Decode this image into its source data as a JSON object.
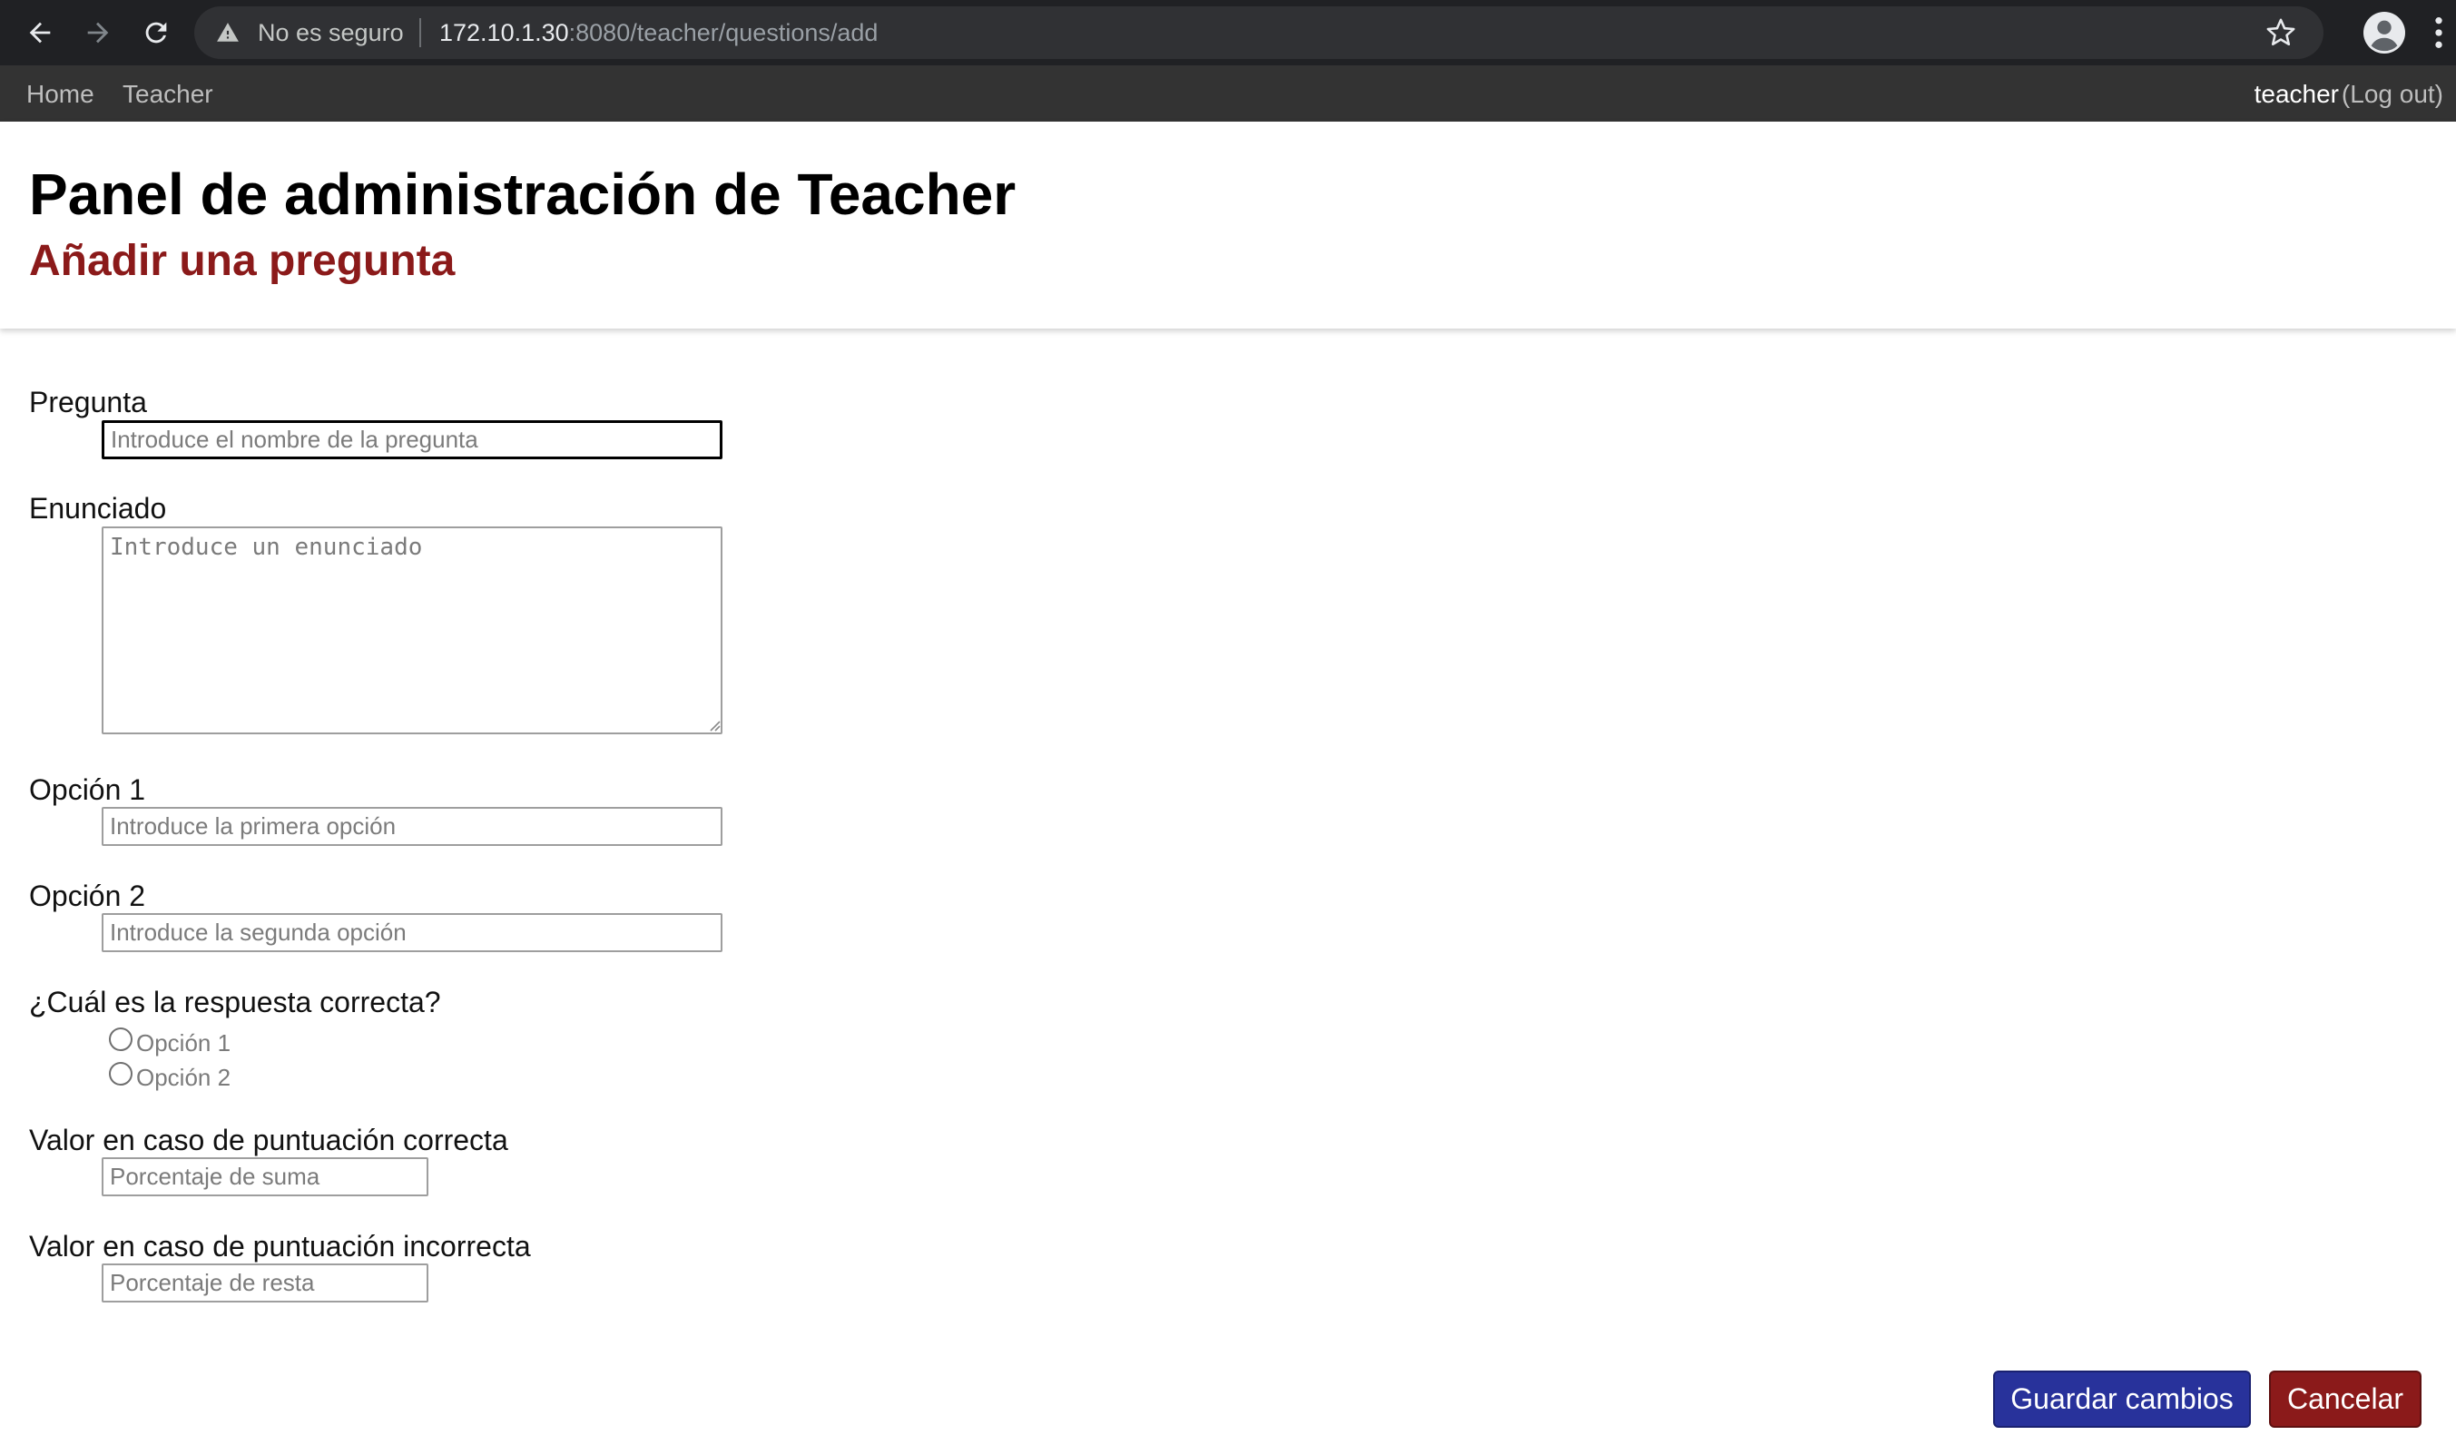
{
  "browser": {
    "security_text": "No es seguro",
    "url_host": "172.10.1.30",
    "url_rest": ":8080/teacher/questions/add",
    "icons": [
      "back-icon",
      "forward-icon",
      "reload-icon",
      "warning-icon",
      "bookmark-star-icon",
      "profile-icon",
      "kebab-menu-icon"
    ]
  },
  "navbar": {
    "home": "Home",
    "teacher": "Teacher",
    "user": "teacher",
    "logout_open": "(",
    "logout": "Log out",
    "logout_close": ")"
  },
  "header": {
    "title": "Panel de administración de Teacher",
    "subtitle": "Añadir una pregunta",
    "subtitle_color": "#8b1a1a"
  },
  "form": {
    "question": {
      "label": "Pregunta",
      "placeholder": "Introduce el nombre de la pregunta",
      "value": ""
    },
    "statement": {
      "label": "Enunciado",
      "placeholder": "Introduce un enunciado",
      "value": ""
    },
    "option1": {
      "label": "Opción 1",
      "placeholder": "Introduce la primera opción",
      "value": ""
    },
    "option2": {
      "label": "Opción 2",
      "placeholder": "Introduce la segunda opción",
      "value": ""
    },
    "correct": {
      "label": "¿Cuál es la respuesta correcta?",
      "options": [
        "Opción 1",
        "Opción 2"
      ],
      "selected": null
    },
    "score_correct": {
      "label": "Valor en caso de puntuación correcta",
      "placeholder": "Porcentaje de suma",
      "value": ""
    },
    "score_incorrect": {
      "label": "Valor en caso de puntuación incorrecta",
      "placeholder": "Porcentaje de resta",
      "value": ""
    }
  },
  "actions": {
    "save": "Guardar cambios",
    "cancel": "Cancelar",
    "save_color": "#28329b",
    "cancel_color": "#8b1a1a"
  }
}
